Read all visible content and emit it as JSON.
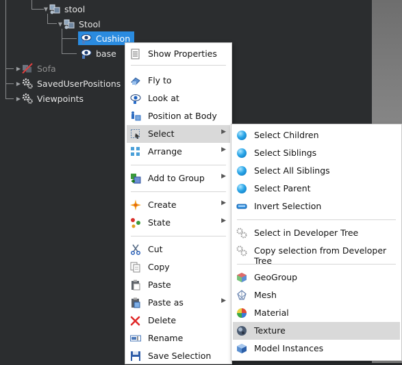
{
  "tree": {
    "nodes": [
      {
        "label": "stool",
        "icon": "group-node-icon"
      },
      {
        "label": "Stool",
        "icon": "group-node-icon"
      },
      {
        "label": "Cushion",
        "icon": "eye-object-icon",
        "selected": true
      },
      {
        "label": "base",
        "icon": "eye-object-icon"
      },
      {
        "label": "Sofa",
        "icon": "hidden-object-icon",
        "dimmed": true
      },
      {
        "label": "SavedUserPositions",
        "icon": "gear-icon"
      },
      {
        "label": "Viewpoints",
        "icon": "gear-icon"
      }
    ]
  },
  "context_menu": {
    "items": [
      {
        "label": "Show Properties",
        "icon": "properties-icon"
      },
      {
        "label": "Fly to",
        "icon": "fly-to-icon"
      },
      {
        "label": "Look at",
        "icon": "look-at-icon"
      },
      {
        "label": "Position at Body",
        "icon": "position-body-icon"
      },
      {
        "label": "Select",
        "icon": "select-icon",
        "submenu": true,
        "highlighted": true
      },
      {
        "label": "Arrange",
        "icon": "arrange-icon",
        "submenu": true
      },
      {
        "label": "Add to Group",
        "icon": "add-group-icon",
        "submenu": true
      },
      {
        "label": "Create",
        "icon": "create-icon",
        "submenu": true
      },
      {
        "label": "State",
        "icon": "state-icon",
        "submenu": true
      },
      {
        "label": "Cut",
        "icon": "scissors-icon"
      },
      {
        "label": "Copy",
        "icon": "copy-icon"
      },
      {
        "label": "Paste",
        "icon": "paste-icon"
      },
      {
        "label": "Paste as",
        "icon": "paste-as-icon",
        "submenu": true
      },
      {
        "label": "Delete",
        "icon": "delete-icon"
      },
      {
        "label": "Rename",
        "icon": "rename-icon"
      },
      {
        "label": "Save Selection",
        "icon": "save-icon"
      }
    ]
  },
  "select_submenu": {
    "items": [
      {
        "label": "Select Children",
        "icon": "sphere-icon"
      },
      {
        "label": "Select Siblings",
        "icon": "sphere-icon"
      },
      {
        "label": "Select All Siblings",
        "icon": "sphere-icon"
      },
      {
        "label": "Select Parent",
        "icon": "sphere-icon"
      },
      {
        "label": "Invert Selection",
        "icon": "invert-icon"
      },
      {
        "label": "Select in Developer Tree",
        "icon": "dev-tree-icon"
      },
      {
        "label": "Copy selection from Developer Tree",
        "icon": "dev-tree-icon"
      },
      {
        "label": "GeoGroup",
        "icon": "geogroup-icon"
      },
      {
        "label": "Mesh",
        "icon": "mesh-icon"
      },
      {
        "label": "Material",
        "icon": "material-icon"
      },
      {
        "label": "Texture",
        "icon": "texture-icon",
        "highlighted": true
      },
      {
        "label": "Model Instances",
        "icon": "model-instances-icon"
      }
    ]
  },
  "colors": {
    "selection": "#2a8be0",
    "menu_highlight": "#d9d9d9",
    "tree_bg": "#2b2d2f"
  }
}
